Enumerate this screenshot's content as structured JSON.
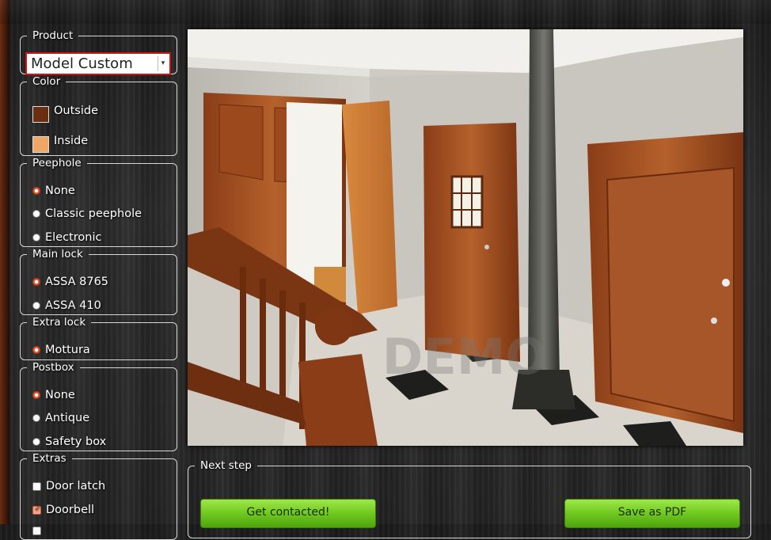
{
  "product": {
    "legend": "Product",
    "selected": "Model Custom"
  },
  "color": {
    "legend": "Color",
    "items": [
      {
        "label": "Outside",
        "swatch": "#6a2f10"
      },
      {
        "label": "Inside",
        "swatch": "#efa768"
      }
    ]
  },
  "peephole": {
    "legend": "Peephole",
    "options": [
      {
        "label": "None",
        "checked": true
      },
      {
        "label": "Classic peephole",
        "checked": false
      },
      {
        "label": "Electronic",
        "checked": false
      }
    ]
  },
  "main_lock": {
    "legend": "Main lock",
    "options": [
      {
        "label": "ASSA 8765",
        "checked": true
      },
      {
        "label": "ASSA 410",
        "checked": false
      }
    ]
  },
  "extra_lock": {
    "legend": "Extra lock",
    "options": [
      {
        "label": "Mottura",
        "checked": true
      }
    ]
  },
  "postbox": {
    "legend": "Postbox",
    "options": [
      {
        "label": "None",
        "checked": true
      },
      {
        "label": "Antique",
        "checked": false
      },
      {
        "label": "Safety box",
        "checked": false
      }
    ]
  },
  "extras": {
    "legend": "Extras",
    "options": [
      {
        "label": "Door latch",
        "checked": false
      },
      {
        "label": "Doorbell",
        "checked": true
      },
      {
        "label": "",
        "checked": false
      }
    ]
  },
  "preview": {
    "watermark": "DEMO"
  },
  "next_step": {
    "legend": "Next step",
    "contact_label": "Get contacted!",
    "pdf_label": "Save as PDF"
  }
}
